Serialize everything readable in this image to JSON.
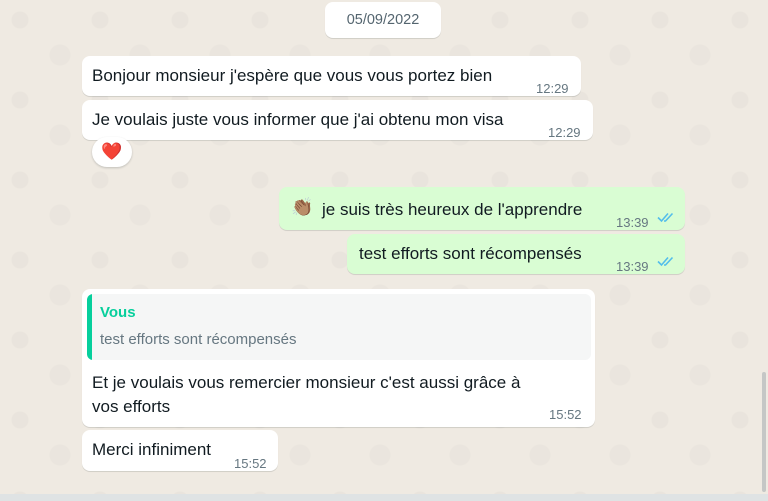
{
  "date_chip": "05/09/2022",
  "messages": [
    {
      "text": "Bonjour monsieur j'espère que vous vous portez bien",
      "time": "12:29"
    },
    {
      "text": "Je voulais juste vous informer que j'ai obtenu mon visa",
      "time": "12:29",
      "reaction": "❤️"
    },
    {
      "emoji": "👏🏽",
      "text": "je suis très heureux de l'apprendre",
      "time": "13:39"
    },
    {
      "text": "test efforts sont récompensés",
      "time": "13:39"
    },
    {
      "quote": {
        "author": "Vous",
        "text": "test efforts sont récompensés"
      },
      "lines": [
        "Et je voulais vous remercier monsieur c'est aussi grâce à",
        "vos efforts"
      ],
      "time": "15:52"
    },
    {
      "text": "Merci infiniment",
      "time": "15:52"
    }
  ],
  "colors": {
    "background": "#efeae2",
    "incoming_bubble": "#ffffff",
    "outgoing_bubble": "#d9fdd3",
    "read_ticks": "#53bdeb",
    "quote_accent": "#06cf9c",
    "time_text": "#667781"
  },
  "icons": {
    "read_receipt": "double-check-icon"
  }
}
